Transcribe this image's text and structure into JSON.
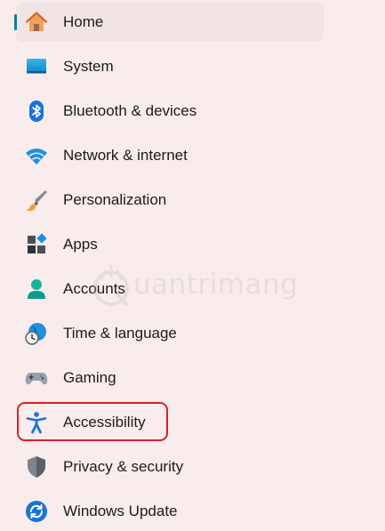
{
  "colors": {
    "background": "#f9ecec",
    "selected_background": "#f1e4e4",
    "selected_indicator": "#0f7f95",
    "highlight_border": "#e01e26"
  },
  "nav": {
    "items": [
      {
        "label": "Home",
        "icon": "home-icon",
        "selected": true
      },
      {
        "label": "System",
        "icon": "system-icon"
      },
      {
        "label": "Bluetooth & devices",
        "icon": "bluetooth-icon"
      },
      {
        "label": "Network & internet",
        "icon": "wifi-icon"
      },
      {
        "label": "Personalization",
        "icon": "paintbrush-icon"
      },
      {
        "label": "Apps",
        "icon": "apps-icon"
      },
      {
        "label": "Accounts",
        "icon": "account-icon"
      },
      {
        "label": "Time & language",
        "icon": "globe-clock-icon"
      },
      {
        "label": "Gaming",
        "icon": "gamepad-icon"
      },
      {
        "label": "Accessibility",
        "icon": "accessibility-icon",
        "highlighted": true
      },
      {
        "label": "Privacy & security",
        "icon": "shield-icon"
      },
      {
        "label": "Windows Update",
        "icon": "windows-update-icon"
      }
    ]
  },
  "watermark": {
    "text": "uantrimang",
    "icon": "quantrimang-logo-icon"
  }
}
